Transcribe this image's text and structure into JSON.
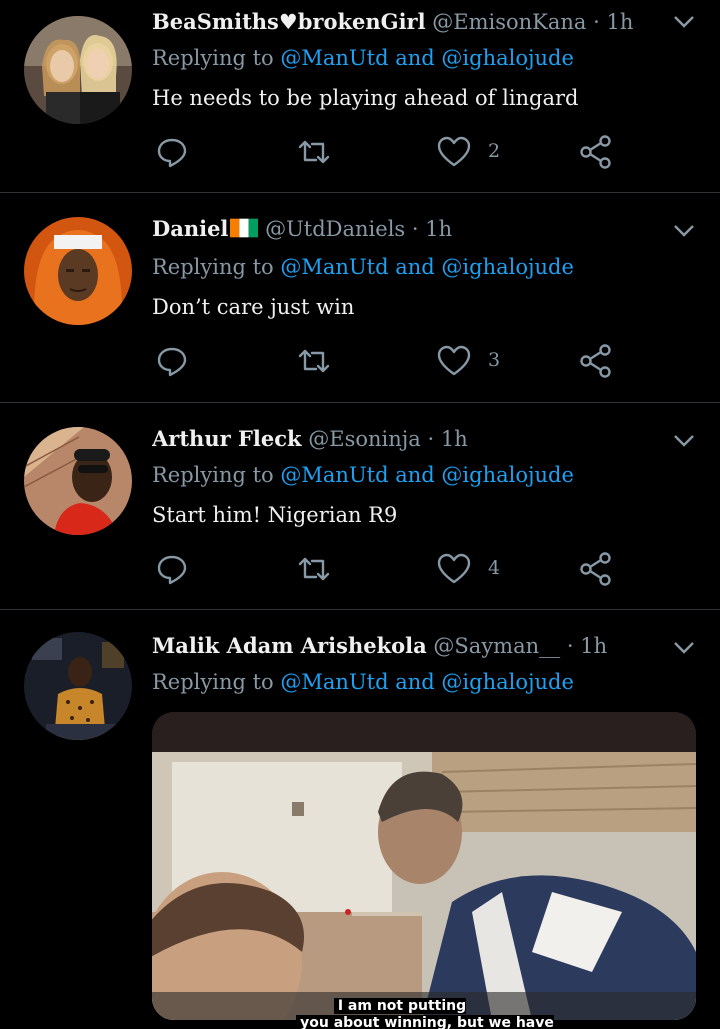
{
  "tweets": [
    {
      "name": "BeaSmiths♥brokenGirl",
      "handle": "@EmisonKana",
      "dot": "·",
      "time": "1h",
      "replying_prefix": "Replying to",
      "mention1": "@ManUtd",
      "and": "and",
      "mention2": "@ighalojude",
      "text": "He needs to be playing ahead of lingard",
      "likes": "2"
    },
    {
      "name": "Daniel",
      "flag": "🇨🇮",
      "handle": "@UtdDaniels",
      "dot": "·",
      "time": "1h",
      "replying_prefix": "Replying to",
      "mention1": "@ManUtd",
      "and": "and",
      "mention2": "@ighalojude",
      "text": "Don’t care just win",
      "likes": "3"
    },
    {
      "name": "Arthur Fleck",
      "handle": "@Esoninja",
      "dot": "·",
      "time": "1h",
      "replying_prefix": "Replying to",
      "mention1": "@ManUtd",
      "and": "and",
      "mention2": "@ighalojude",
      "text": "Start him! Nigerian R9",
      "likes": "4"
    },
    {
      "name": "Malik Adam Arishekola",
      "handle": "@Sayman__",
      "dot": "·",
      "time": "1h",
      "replying_prefix": "Replying to",
      "mention1": "@ManUtd",
      "and": "and",
      "mention2": "@ighalojude",
      "caption_line1": "I am not putting pressure on",
      "caption_line2": "you about winning, but we have to win"
    }
  ],
  "icons": {
    "reply": "reply-icon",
    "retweet": "retweet-icon",
    "like": "heart-icon",
    "share": "share-icon",
    "menu": "chevron-down-icon"
  },
  "colors": {
    "background": "#000000",
    "mention": "#1da1f2",
    "secondary": "#8899a6",
    "divider": "#2f3336"
  }
}
